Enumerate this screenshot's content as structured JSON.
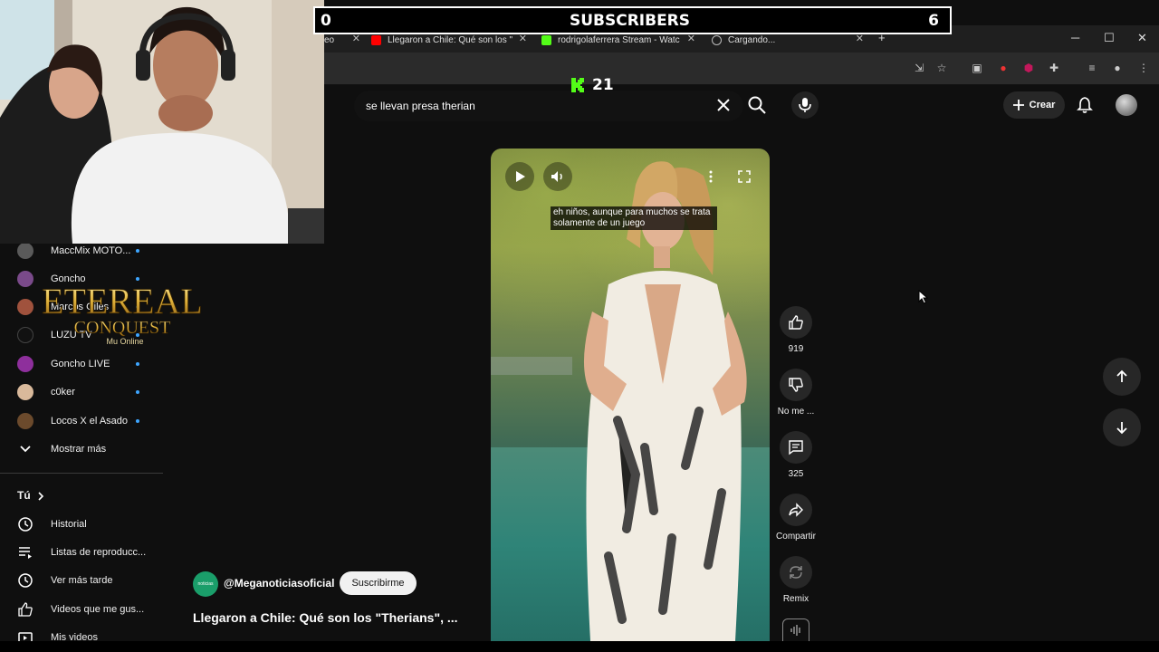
{
  "overlay": {
    "subscribers_left": "0",
    "subscribers_label": "SUBSCRIBERS",
    "subscribers_right": "6",
    "kick_viewers": "21"
  },
  "browser": {
    "tabs": [
      {
        "title": "eo",
        "icon": "generic-tab-icon"
      },
      {
        "title": "Llegaron a Chile: Qué son los \"",
        "icon": "youtube-icon"
      },
      {
        "title": "rodrigolaferrera Stream - Watc",
        "icon": "kick-icon"
      },
      {
        "title": "Cargando...",
        "icon": "loading-icon"
      }
    ],
    "new_tab": "+"
  },
  "header": {
    "search_query": "se llevan presa therian",
    "create_label": "Crear"
  },
  "sidebar": {
    "subscriptions": [
      {
        "name": "MaccMix MOTO...",
        "color": "#5a5a5a",
        "live": true
      },
      {
        "name": "Goncho",
        "color": "#7a4a8a",
        "live": true
      },
      {
        "name": "Marcos Giles",
        "color": "#a0523d",
        "live": true
      },
      {
        "name": "LUZU TV",
        "color": "#111111",
        "live": true
      },
      {
        "name": "Goncho LIVE",
        "color": "#8e2f9c",
        "live": true
      },
      {
        "name": "c0ker",
        "color": "#d9b99b",
        "live": true
      },
      {
        "name": "Locos X el Asado",
        "color": "#6b4a2c",
        "live": true
      }
    ],
    "show_more": "Mostrar más",
    "you_section": "Tú",
    "nav": [
      {
        "label": "Historial",
        "icon": "history-icon"
      },
      {
        "label": "Listas de reproducc...",
        "icon": "playlist-icon"
      },
      {
        "label": "Ver más tarde",
        "icon": "clock-icon"
      },
      {
        "label": "Videos que me gus...",
        "icon": "like-icon"
      },
      {
        "label": "Mis videos",
        "icon": "my-videos-icon"
      }
    ]
  },
  "logo": {
    "line1": "ETEREAL",
    "line2": "CONQUEST",
    "line3": "Mu Online"
  },
  "short": {
    "caption": "eh niños, aunque para muchos se trata solamente de un juego",
    "likes": "919",
    "dislike_label": "No me ...",
    "comments": "325",
    "share_label": "Compartir",
    "remix_label": "Remix"
  },
  "channel": {
    "handle": "@Meganoticiasoficial",
    "subscribe_label": "Suscribirme",
    "avatar_text": "noticias",
    "video_title": "Llegaron a Chile: Qué son los \"Therians\", ..."
  }
}
